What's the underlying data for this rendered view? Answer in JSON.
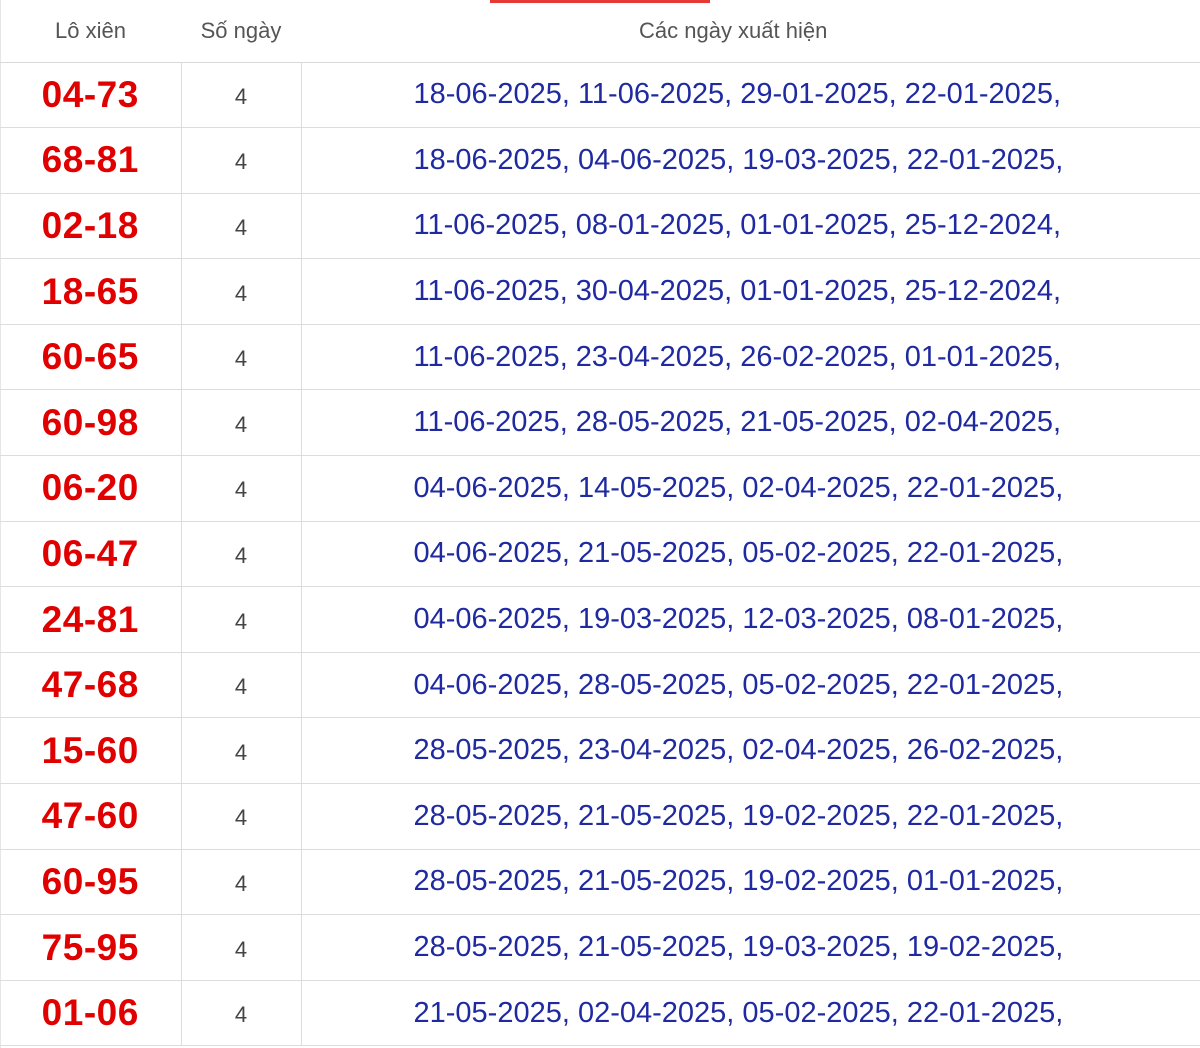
{
  "header": {
    "col_pair": "Lô xiên",
    "col_count": "Số ngày",
    "col_dates": "Các ngày xuất hiện"
  },
  "rows": [
    {
      "pair": "04-73",
      "count": "4",
      "dates": "18-06-2025, 11-06-2025, 29-01-2025, 22-01-2025,"
    },
    {
      "pair": "68-81",
      "count": "4",
      "dates": "18-06-2025, 04-06-2025, 19-03-2025, 22-01-2025,"
    },
    {
      "pair": "02-18",
      "count": "4",
      "dates": "11-06-2025, 08-01-2025, 01-01-2025, 25-12-2024,"
    },
    {
      "pair": "18-65",
      "count": "4",
      "dates": "11-06-2025, 30-04-2025, 01-01-2025, 25-12-2024,"
    },
    {
      "pair": "60-65",
      "count": "4",
      "dates": "11-06-2025, 23-04-2025, 26-02-2025, 01-01-2025,"
    },
    {
      "pair": "60-98",
      "count": "4",
      "dates": "11-06-2025, 28-05-2025, 21-05-2025, 02-04-2025,"
    },
    {
      "pair": "06-20",
      "count": "4",
      "dates": "04-06-2025, 14-05-2025, 02-04-2025, 22-01-2025,"
    },
    {
      "pair": "06-47",
      "count": "4",
      "dates": "04-06-2025, 21-05-2025, 05-02-2025, 22-01-2025,"
    },
    {
      "pair": "24-81",
      "count": "4",
      "dates": "04-06-2025, 19-03-2025, 12-03-2025, 08-01-2025,"
    },
    {
      "pair": "47-68",
      "count": "4",
      "dates": "04-06-2025, 28-05-2025, 05-02-2025, 22-01-2025,"
    },
    {
      "pair": "15-60",
      "count": "4",
      "dates": "28-05-2025, 23-04-2025, 02-04-2025, 26-02-2025,"
    },
    {
      "pair": "47-60",
      "count": "4",
      "dates": "28-05-2025, 21-05-2025, 19-02-2025, 22-01-2025,"
    },
    {
      "pair": "60-95",
      "count": "4",
      "dates": "28-05-2025, 21-05-2025, 19-02-2025, 01-01-2025,"
    },
    {
      "pair": "75-95",
      "count": "4",
      "dates": "28-05-2025, 21-05-2025, 19-03-2025, 19-02-2025,"
    },
    {
      "pair": "01-06",
      "count": "4",
      "dates": "21-05-2025, 02-04-2025, 05-02-2025, 22-01-2025,"
    }
  ],
  "colors": {
    "pair_text": "#e00000",
    "dates_text": "#1f2aa0",
    "accent": "#e53935"
  }
}
